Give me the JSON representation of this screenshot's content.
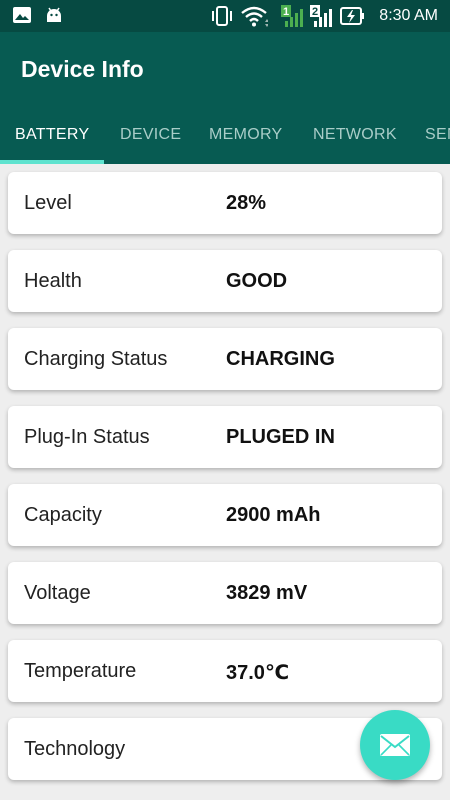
{
  "status_bar": {
    "time": "8:30 AM",
    "icons": [
      "image-icon",
      "android-icon",
      "vibrate-icon",
      "wifi-icon",
      "sim1-signal-icon",
      "sim2-signal-icon",
      "battery-charging-icon"
    ],
    "sim1_label": "1",
    "sim2_label": "2"
  },
  "app": {
    "title": "Device Info"
  },
  "tabs": [
    {
      "label": "BATTERY",
      "active": true
    },
    {
      "label": "DEVICE",
      "active": false
    },
    {
      "label": "MEMORY",
      "active": false
    },
    {
      "label": "NETWORK",
      "active": false
    },
    {
      "label": "SEN",
      "active": false
    }
  ],
  "battery_items": [
    {
      "label": "Level",
      "value": "28%"
    },
    {
      "label": "Health",
      "value": "GOOD"
    },
    {
      "label": "Charging Status",
      "value": "CHARGING"
    },
    {
      "label": "Plug-In Status",
      "value": "PLUGED IN"
    },
    {
      "label": "Capacity",
      "value": "2900 mAh"
    },
    {
      "label": "Voltage",
      "value": "3829 mV"
    },
    {
      "label": "Temperature",
      "value": "37.0℃"
    },
    {
      "label": "Technology",
      "value": ""
    }
  ],
  "fab": {
    "icon": "mail-icon"
  },
  "colors": {
    "status_bar": "#064a42",
    "primary": "#075b52",
    "accent": "#39dbc5",
    "tab_indicator": "#5fe3cf",
    "background": "#eeeeee"
  }
}
